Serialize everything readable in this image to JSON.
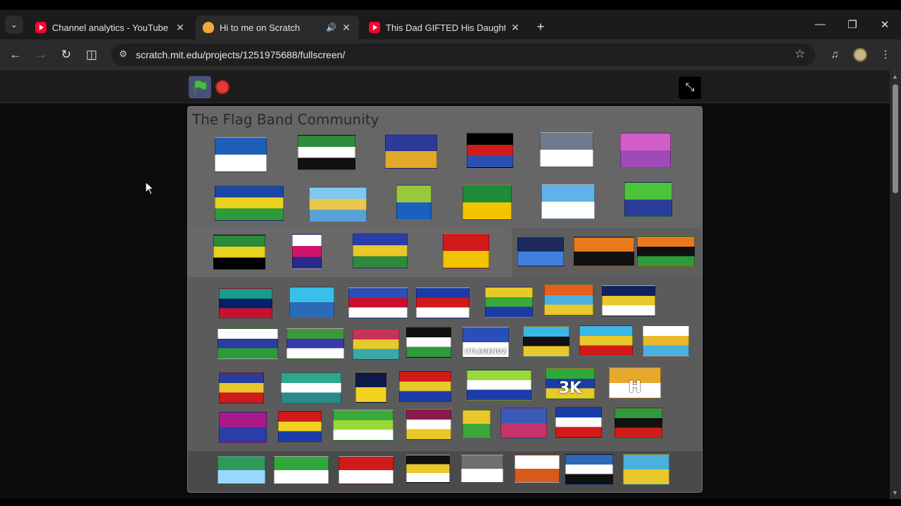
{
  "browser": {
    "tabs": [
      {
        "title": "Channel analytics - YouTube Studio",
        "favicon": "youtube-icon",
        "active": false
      },
      {
        "title": "Hi to me on Scratch",
        "favicon": "scratch-icon",
        "active": true,
        "audio": true
      },
      {
        "title": "This Dad GIFTED His Daughter a Car",
        "favicon": "youtube-icon",
        "active": false
      }
    ],
    "url": "scratch.mit.edu/projects/1251975688/fullscreen/",
    "window_controls": [
      "minimize-icon",
      "restore-icon",
      "close-icon"
    ]
  },
  "scratch": {
    "stage_title": "The Flag Band Community",
    "controls": [
      "green-flag-icon",
      "stop-icon",
      "exit-fullscreen-icon"
    ]
  },
  "flags": [
    {
      "name": "bavaria-flag",
      "colors": [
        "#1e5fb8",
        "#ffffff"
      ]
    },
    {
      "name": "green-saltire-flag",
      "colors": [
        "#2e8b3d",
        "#ffffff",
        "#111111"
      ]
    },
    {
      "name": "gears-flag",
      "colors": [
        "#2c3a9a",
        "#e2a82a"
      ]
    },
    {
      "name": "star-circle-flag",
      "colors": [
        "#000000",
        "#d01c1c",
        "#2a4fb0"
      ]
    },
    {
      "name": "grey-star-flag",
      "colors": [
        "#6e7b8a",
        "#ffffff"
      ]
    },
    {
      "name": "pink-stripes-flag",
      "colors": [
        "#d35ec8",
        "#a04ab8"
      ]
    },
    {
      "name": "blue-map-flag",
      "colors": [
        "#1b46a8",
        "#e8d21f",
        "#2e9a3c"
      ]
    },
    {
      "name": "sky-sun-flag",
      "colors": [
        "#7ec8f0",
        "#e8c84a",
        "#5aa0d8"
      ]
    },
    {
      "name": "green-cross-flag",
      "colors": [
        "#9ac83c",
        "#1b5fbf"
      ]
    },
    {
      "name": "green-diamond-flag",
      "colors": [
        "#1e8a3a",
        "#f2c400"
      ]
    },
    {
      "name": "light-blue-flag",
      "colors": [
        "#5fb3e8",
        "#ffffff"
      ]
    },
    {
      "name": "green-emblem-flag",
      "colors": [
        "#4cc43a",
        "#2a3d9a"
      ]
    },
    {
      "name": "triangle-stripes-flag",
      "colors": [
        "#2a8a3a",
        "#e8d21f",
        "#000000"
      ]
    },
    {
      "name": "pennant-flag",
      "colors": [
        "#ffffff",
        "#d0146c",
        "#2a2a8a"
      ]
    },
    {
      "name": "trillium-flag",
      "colors": [
        "#2a3da8",
        "#e8c82a",
        "#2e8a3a"
      ]
    },
    {
      "name": "red-star-flag",
      "colors": [
        "#d11a1a",
        "#f2c400"
      ]
    },
    {
      "name": "blue-saltire-flag",
      "colors": [
        "#1b2a5a",
        "#3f7fe0"
      ]
    },
    {
      "name": "orange-crescent-flag",
      "colors": [
        "#e87a1a",
        "#111111"
      ]
    },
    {
      "name": "orange-fleur-flag",
      "colors": [
        "#e87a1a",
        "#111111",
        "#2e9a3c"
      ]
    },
    {
      "name": "union-shield-flag",
      "colors": [
        "#1a9a8a",
        "#012169",
        "#c8102e"
      ]
    },
    {
      "name": "cyan-letter-flag",
      "colors": [
        "#38c0e8",
        "#2a6ab8"
      ]
    },
    {
      "name": "chevron-cross-flag",
      "colors": [
        "#2a4fb8",
        "#c8102e",
        "#ffffff"
      ]
    },
    {
      "name": "red-cross-blue-flag",
      "colors": [
        "#1b3ca8",
        "#d11a1a",
        "#ffffff"
      ]
    },
    {
      "name": "yellow-green-blue-flag",
      "colors": [
        "#e8c82a",
        "#3aa83a",
        "#1b3ca8"
      ]
    },
    {
      "name": "orange-diagonal-flag",
      "colors": [
        "#e8601a",
        "#4ab0e0",
        "#e8c82a"
      ]
    },
    {
      "name": "navy-stars-flag",
      "colors": [
        "#12215e",
        "#e8c82a",
        "#ffffff"
      ]
    },
    {
      "name": "wave-stripes-flag",
      "colors": [
        "#ffffff",
        "#2a3d9a",
        "#2e9a3c"
      ]
    },
    {
      "name": "tiger-flag",
      "colors": [
        "#3a9a3a",
        "#3a3aa8",
        "#ffffff"
      ]
    },
    {
      "name": "abstract-flag",
      "colors": [
        "#c8325a",
        "#e8c82a",
        "#3aa8a8"
      ]
    },
    {
      "name": "black-star-lines-flag",
      "colors": [
        "#111111",
        "#ffffff",
        "#2e9a3c"
      ]
    },
    {
      "name": "ctlegendz-flag",
      "colors": [
        "#2a4fb8",
        "#ffffff"
      ],
      "text": "CTLEGENDZ"
    },
    {
      "name": "eye-triangle-flag",
      "colors": [
        "#38b8e8",
        "#111111",
        "#e8c82a"
      ]
    },
    {
      "name": "diamond-star-flag",
      "colors": [
        "#38b8e8",
        "#e8c82a",
        "#d11a1a"
      ]
    },
    {
      "name": "white-disc-flag",
      "colors": [
        "#ffffff",
        "#e8b82a",
        "#4ab0e0"
      ]
    },
    {
      "name": "gear-chevron-flag",
      "colors": [
        "#2a3d9a",
        "#e8c82a",
        "#d11a1a"
      ]
    },
    {
      "name": "teal-stars-flag",
      "colors": [
        "#2ea88a",
        "#ffffff",
        "#2a8a8a"
      ]
    },
    {
      "name": "navy-yellow-disc-flag",
      "colors": [
        "#0e1a4a",
        "#f2d21f"
      ]
    },
    {
      "name": "red-yellow-blue-flag",
      "colors": [
        "#d11a1a",
        "#e8c82a",
        "#1b3ca8"
      ]
    },
    {
      "name": "lime-star-flag",
      "colors": [
        "#9ad83a",
        "#ffffff",
        "#1b3ca8"
      ]
    },
    {
      "name": "3k-flag",
      "colors": [
        "#2ea83a",
        "#1b3ca8",
        "#e8c82a"
      ],
      "text": "3K"
    },
    {
      "name": "h-flag",
      "colors": [
        "#e8a82a",
        "#ffffff"
      ],
      "text": "H"
    },
    {
      "name": "purple-blue-flag",
      "colors": [
        "#a81a8a",
        "#2a3da8"
      ]
    },
    {
      "name": "sun-star-flag",
      "colors": [
        "#d11a1a",
        "#f2d21f",
        "#1b3ca8"
      ]
    },
    {
      "name": "green-diagonal-flag",
      "colors": [
        "#3aa83a",
        "#9ad83a",
        "#ffffff"
      ]
    },
    {
      "name": "maroon-wheel-flag",
      "colors": [
        "#8a1a4a",
        "#ffffff",
        "#e8c82a"
      ]
    },
    {
      "name": "green-plus-flag",
      "colors": [
        "#e8c82a",
        "#3aa83a"
      ]
    },
    {
      "name": "stripes-red-blue-flag",
      "colors": [
        "#3a5ab8",
        "#c8326a"
      ]
    },
    {
      "name": "red-star-white-flag",
      "colors": [
        "#1b3ca8",
        "#ffffff",
        "#d11a1a"
      ]
    },
    {
      "name": "crescent-tricolor-flag",
      "colors": [
        "#2e9a3c",
        "#111111",
        "#d11a1a"
      ]
    },
    {
      "name": "stars-grid-flag",
      "colors": [
        "#2e9a5a",
        "#9ad8ff"
      ]
    },
    {
      "name": "green-suns-flag",
      "colors": [
        "#2ea83a",
        "#ffffff"
      ]
    },
    {
      "name": "red-triangle-flag",
      "colors": [
        "#d11a1a",
        "#ffffff"
      ]
    },
    {
      "name": "pear-flag",
      "colors": [
        "#111111",
        "#e8c82a",
        "#ffffff"
      ]
    },
    {
      "name": "grey-circle-flag",
      "colors": [
        "#707070",
        "#ffffff"
      ]
    },
    {
      "name": "half-circle-flag",
      "colors": [
        "#ffffff",
        "#d85a1a"
      ]
    },
    {
      "name": "blue-diamond-flag",
      "colors": [
        "#2a6ab8",
        "#ffffff",
        "#111111"
      ]
    },
    {
      "name": "yellow-blue-stripes-flag",
      "colors": [
        "#4ab0e0",
        "#e8c82a"
      ]
    }
  ]
}
